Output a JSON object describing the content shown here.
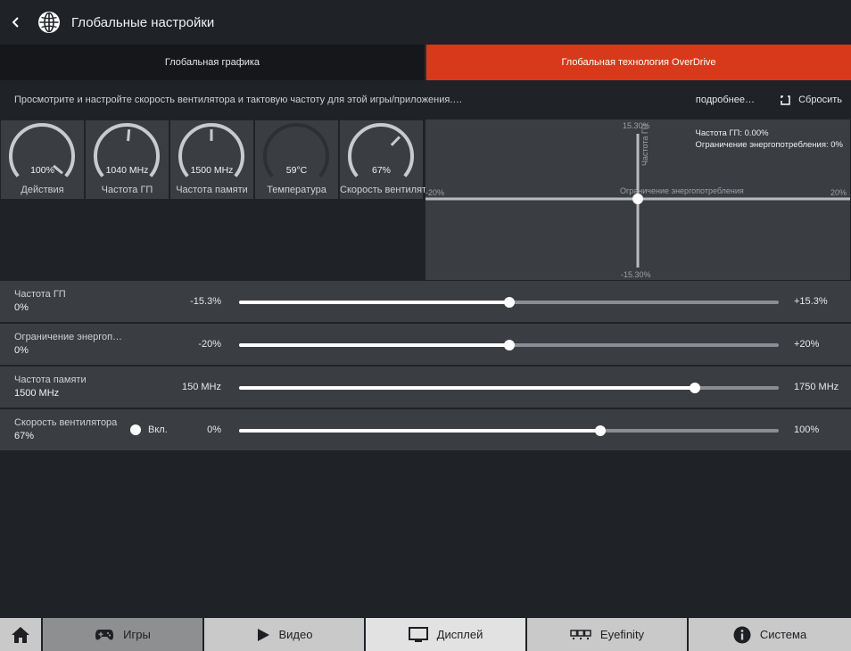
{
  "header": {
    "back_icon": "chevron-left-icon",
    "globe_icon": "globe-icon",
    "title": "Глобальные настройки"
  },
  "tabs": [
    {
      "label": "Глобальная графика",
      "active": false
    },
    {
      "label": "Глобальная технология OverDrive",
      "active": true
    }
  ],
  "colors": {
    "accent": "#d9391b",
    "panel": "#3a3d42",
    "background": "#1f2227"
  },
  "description": {
    "text": "Просмотрите и настройте скорость вентилятора и тактовую частоту для этой игры/приложения.…",
    "more_label": "подробнее…",
    "reset_label": "Сбросить",
    "reset_icon": "reset-icon"
  },
  "gauges": [
    {
      "value": "100%",
      "label": "Действия",
      "level": 1.0,
      "enabled": true
    },
    {
      "value": "1040 MHz",
      "label": "Частота ГП",
      "level": 0.52,
      "enabled": true
    },
    {
      "value": "1500 MHz",
      "label": "Частота памяти",
      "level": 0.5,
      "enabled": true
    },
    {
      "value": "59°C",
      "label": "Температура",
      "level": 0.0,
      "enabled": false
    },
    {
      "value": "67%",
      "label": "Скорость вентилятора",
      "level": 0.67,
      "enabled": true
    }
  ],
  "graph": {
    "y_top": "15.30%",
    "y_bottom": "-15.30%",
    "x_left": "-20%",
    "x_right": "20%",
    "y_axis_label": "Частота ГП",
    "x_axis_label": "Ограничение энергопотребления",
    "info_gpu": "Частота ГП: 0.00%",
    "info_power": "Ограничение энергопотребления: 0%"
  },
  "sliders": [
    {
      "label": "Частота ГП",
      "value": "0%",
      "min": "-15.3%",
      "max": "+15.3%",
      "position": 0.5
    },
    {
      "label": "Ограничение энергоп…",
      "value": "0%",
      "min": "-20%",
      "max": "+20%",
      "position": 0.5
    },
    {
      "label": "Частота памяти",
      "value": "1500 MHz",
      "min": "150 MHz",
      "max": "1750 MHz",
      "position": 0.845
    },
    {
      "label": "Скорость вентилятора",
      "value": "67%",
      "min": "0%",
      "max": "100%",
      "position": 0.67,
      "toggle_label": "Вкл."
    }
  ],
  "bottom_nav": [
    {
      "label": "",
      "icon": "home-icon"
    },
    {
      "label": "Игры",
      "icon": "gamepad-icon"
    },
    {
      "label": "Видео",
      "icon": "play-icon"
    },
    {
      "label": "Дисплей",
      "icon": "monitor-icon"
    },
    {
      "label": "Eyefinity",
      "icon": "eyefinity-icon"
    },
    {
      "label": "Система",
      "icon": "info-icon"
    }
  ]
}
